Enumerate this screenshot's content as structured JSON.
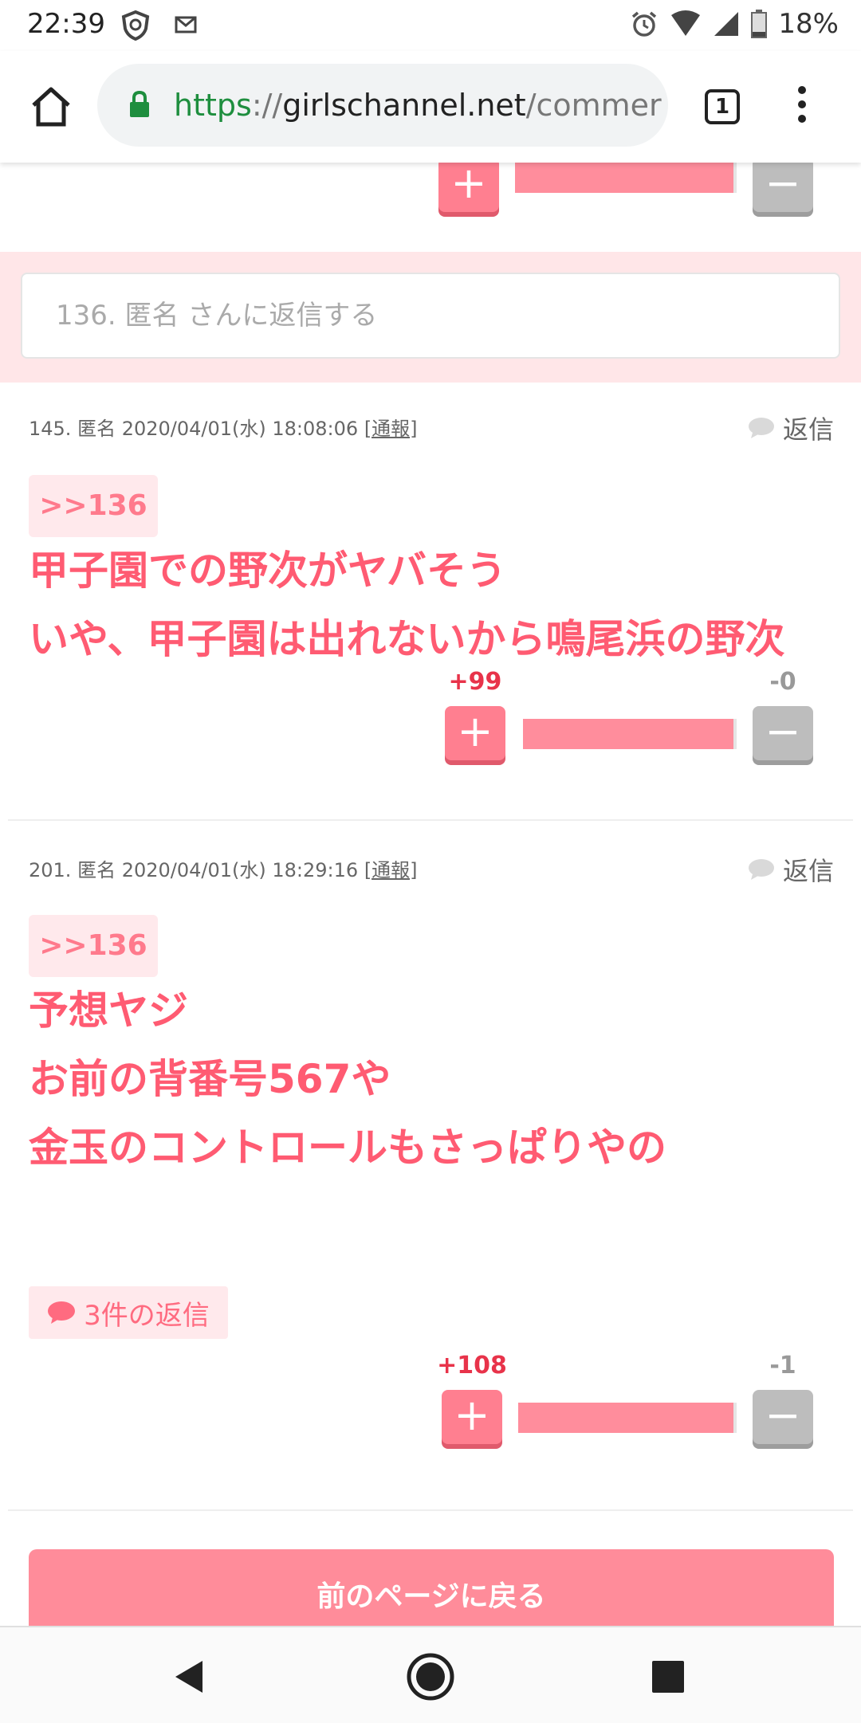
{
  "status_bar": {
    "time": "22:39",
    "battery": "18%"
  },
  "browser": {
    "url_scheme": "https",
    "url_sep": "://",
    "url_host": "girlschannel.net",
    "url_path": "/commer",
    "tab_count": "1"
  },
  "reply_box": {
    "placeholder": "136. 匿名 さんに返信する"
  },
  "top_votes": {
    "plus": "+",
    "minus": "−"
  },
  "comments": [
    {
      "meta": "145. 匿名 2020/04/01(水) 18:08:06",
      "report": "[通報]",
      "reply_label": "返信",
      "anchor": ">>136",
      "lines": [
        "甲子園での野次がヤバそう",
        "いや、甲子園は出れないから鳴尾浜の野次"
      ],
      "plus_count": "+99",
      "minus_count": "-0",
      "plus_btn": "+",
      "minus_btn": "−"
    },
    {
      "meta": "201. 匿名 2020/04/01(水) 18:29:16",
      "report": "[通報]",
      "reply_label": "返信",
      "anchor": ">>136",
      "lines": [
        "予想ヤジ",
        "お前の背番号567や",
        "金玉のコントロールもさっぱりやの"
      ],
      "replies_badge": "3件の返信",
      "plus_count": "+108",
      "minus_count": "-1",
      "plus_btn": "+",
      "minus_btn": "−"
    }
  ],
  "prev_page_button": "前のページに戻る",
  "colors": {
    "accent": "#ff5b72",
    "vote_plus": "#ff7f90",
    "vote_minus": "#bdbdbd",
    "reply_band": "#ffe6e8"
  }
}
